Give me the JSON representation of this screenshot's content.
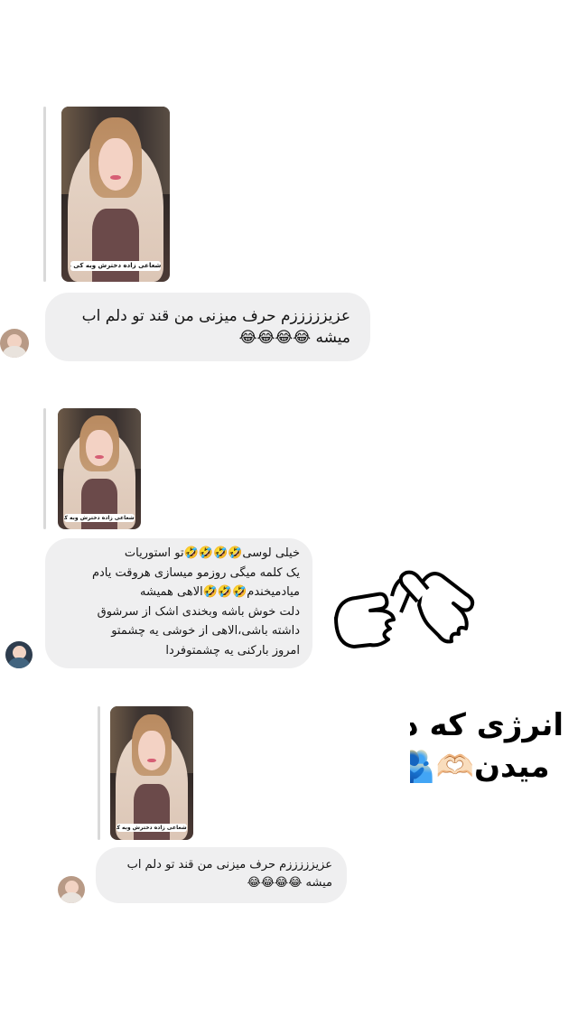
{
  "posts": [
    {
      "story_caption": "شعاعی زاده دخترش وبه کی داد اخر؟!",
      "reply_lines": [
        "عزیزززززم حرف میزنی من قند تو دلم اب",
        "میشه 😂😂😂😂"
      ]
    },
    {
      "story_caption": "شعاعی زاده دخترش وبه کی داد اخر؟!",
      "reply_lines": [
        "خیلی لوسی🤣🤣🤣🤣تو استوریات",
        "یک کلمه میگی روزمو میسازی هروقت یادم",
        "میادمیخندم🤣🤣🤣الاهی همیشه",
        "دلت خوش باشه وبخندی اشک از سرشوق",
        "داشته باشی،الاهی از خوشی یه چشمتو",
        "امروز بارکنی یه چشمتوفردا"
      ]
    },
    {
      "story_caption": "شعاعی زاده دخترش وبه کی داد اخر؟!",
      "reply_lines": [
        "عزیزززززم حرف میزنی من قند تو دلم اب",
        "میشه 😂😂😂😂"
      ]
    }
  ],
  "headline_lines": [
    "انرژی که دخترای گلم بهم",
    "میدن🫶🏻🫂🥰عاشقتونم"
  ],
  "icons": {
    "pointing_hands": "pointing-hands-sticker",
    "avatar": "user-avatar"
  }
}
